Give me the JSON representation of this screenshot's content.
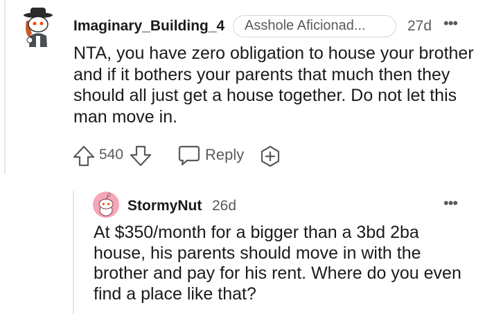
{
  "comment": {
    "author": "Imaginary_Building_4",
    "flair": "Asshole Aficionad...",
    "age": "27d",
    "more": "•••",
    "body": "NTA, you have zero obligation to house your brother and if it bothers your parents that much then they should all just get a house together. Do not let this man move in.",
    "score": "540",
    "reply_label": "Reply",
    "icons": {
      "avatar": "snoo-avatar-hat",
      "upvote": "upvote-arrow-icon",
      "downvote": "downvote-arrow-icon",
      "reply": "speech-bubble-icon",
      "award": "award-plus-icon"
    }
  },
  "reply": {
    "author": "StormyNut",
    "age": "26d",
    "more": "•••",
    "body": "At $350/month for a bigger than a 3bd 2ba house, his parents should move in with the brother and pay for his rent. Where do you even find a place like that?",
    "icons": {
      "avatar": "default-snoo-avatar-pink"
    }
  },
  "colors": {
    "text": "#1a1a1b",
    "muted": "#575a5c",
    "border": "#d3d6da",
    "avatar_pink": "#f6a6b6"
  }
}
